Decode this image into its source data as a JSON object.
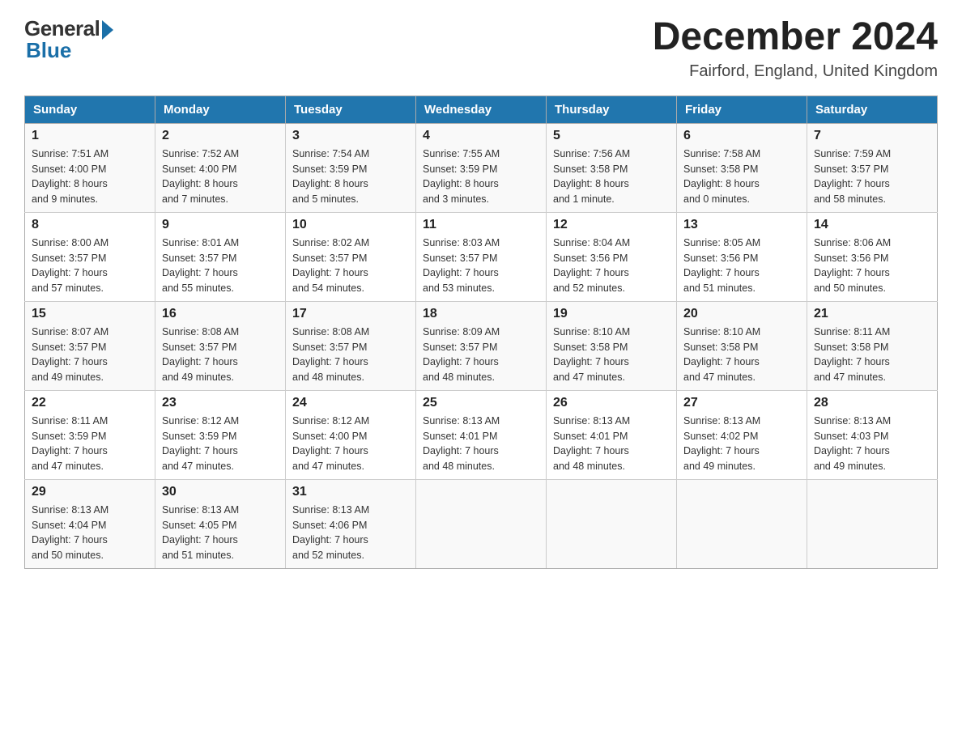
{
  "header": {
    "logo": {
      "general": "General",
      "blue": "Blue"
    },
    "title": "December 2024",
    "location": "Fairford, England, United Kingdom"
  },
  "days_of_week": [
    "Sunday",
    "Monday",
    "Tuesday",
    "Wednesday",
    "Thursday",
    "Friday",
    "Saturday"
  ],
  "weeks": [
    [
      {
        "day": "1",
        "sunrise": "7:51 AM",
        "sunset": "4:00 PM",
        "daylight": "8 hours and 9 minutes."
      },
      {
        "day": "2",
        "sunrise": "7:52 AM",
        "sunset": "4:00 PM",
        "daylight": "8 hours and 7 minutes."
      },
      {
        "day": "3",
        "sunrise": "7:54 AM",
        "sunset": "3:59 PM",
        "daylight": "8 hours and 5 minutes."
      },
      {
        "day": "4",
        "sunrise": "7:55 AM",
        "sunset": "3:59 PM",
        "daylight": "8 hours and 3 minutes."
      },
      {
        "day": "5",
        "sunrise": "7:56 AM",
        "sunset": "3:58 PM",
        "daylight": "8 hours and 1 minute."
      },
      {
        "day": "6",
        "sunrise": "7:58 AM",
        "sunset": "3:58 PM",
        "daylight": "8 hours and 0 minutes."
      },
      {
        "day": "7",
        "sunrise": "7:59 AM",
        "sunset": "3:57 PM",
        "daylight": "7 hours and 58 minutes."
      }
    ],
    [
      {
        "day": "8",
        "sunrise": "8:00 AM",
        "sunset": "3:57 PM",
        "daylight": "7 hours and 57 minutes."
      },
      {
        "day": "9",
        "sunrise": "8:01 AM",
        "sunset": "3:57 PM",
        "daylight": "7 hours and 55 minutes."
      },
      {
        "day": "10",
        "sunrise": "8:02 AM",
        "sunset": "3:57 PM",
        "daylight": "7 hours and 54 minutes."
      },
      {
        "day": "11",
        "sunrise": "8:03 AM",
        "sunset": "3:57 PM",
        "daylight": "7 hours and 53 minutes."
      },
      {
        "day": "12",
        "sunrise": "8:04 AM",
        "sunset": "3:56 PM",
        "daylight": "7 hours and 52 minutes."
      },
      {
        "day": "13",
        "sunrise": "8:05 AM",
        "sunset": "3:56 PM",
        "daylight": "7 hours and 51 minutes."
      },
      {
        "day": "14",
        "sunrise": "8:06 AM",
        "sunset": "3:56 PM",
        "daylight": "7 hours and 50 minutes."
      }
    ],
    [
      {
        "day": "15",
        "sunrise": "8:07 AM",
        "sunset": "3:57 PM",
        "daylight": "7 hours and 49 minutes."
      },
      {
        "day": "16",
        "sunrise": "8:08 AM",
        "sunset": "3:57 PM",
        "daylight": "7 hours and 49 minutes."
      },
      {
        "day": "17",
        "sunrise": "8:08 AM",
        "sunset": "3:57 PM",
        "daylight": "7 hours and 48 minutes."
      },
      {
        "day": "18",
        "sunrise": "8:09 AM",
        "sunset": "3:57 PM",
        "daylight": "7 hours and 48 minutes."
      },
      {
        "day": "19",
        "sunrise": "8:10 AM",
        "sunset": "3:58 PM",
        "daylight": "7 hours and 47 minutes."
      },
      {
        "day": "20",
        "sunrise": "8:10 AM",
        "sunset": "3:58 PM",
        "daylight": "7 hours and 47 minutes."
      },
      {
        "day": "21",
        "sunrise": "8:11 AM",
        "sunset": "3:58 PM",
        "daylight": "7 hours and 47 minutes."
      }
    ],
    [
      {
        "day": "22",
        "sunrise": "8:11 AM",
        "sunset": "3:59 PM",
        "daylight": "7 hours and 47 minutes."
      },
      {
        "day": "23",
        "sunrise": "8:12 AM",
        "sunset": "3:59 PM",
        "daylight": "7 hours and 47 minutes."
      },
      {
        "day": "24",
        "sunrise": "8:12 AM",
        "sunset": "4:00 PM",
        "daylight": "7 hours and 47 minutes."
      },
      {
        "day": "25",
        "sunrise": "8:13 AM",
        "sunset": "4:01 PM",
        "daylight": "7 hours and 48 minutes."
      },
      {
        "day": "26",
        "sunrise": "8:13 AM",
        "sunset": "4:01 PM",
        "daylight": "7 hours and 48 minutes."
      },
      {
        "day": "27",
        "sunrise": "8:13 AM",
        "sunset": "4:02 PM",
        "daylight": "7 hours and 49 minutes."
      },
      {
        "day": "28",
        "sunrise": "8:13 AM",
        "sunset": "4:03 PM",
        "daylight": "7 hours and 49 minutes."
      }
    ],
    [
      {
        "day": "29",
        "sunrise": "8:13 AM",
        "sunset": "4:04 PM",
        "daylight": "7 hours and 50 minutes."
      },
      {
        "day": "30",
        "sunrise": "8:13 AM",
        "sunset": "4:05 PM",
        "daylight": "7 hours and 51 minutes."
      },
      {
        "day": "31",
        "sunrise": "8:13 AM",
        "sunset": "4:06 PM",
        "daylight": "7 hours and 52 minutes."
      },
      null,
      null,
      null,
      null
    ]
  ],
  "labels": {
    "sunrise": "Sunrise:",
    "sunset": "Sunset:",
    "daylight": "Daylight:"
  }
}
